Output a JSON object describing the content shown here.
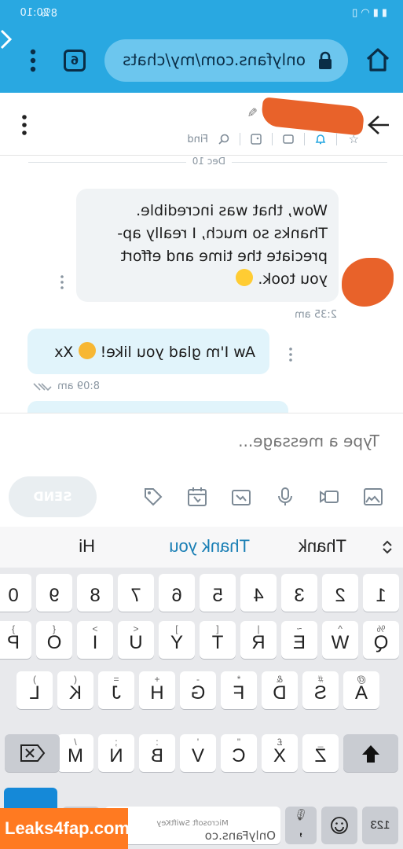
{
  "status_bar": {
    "time": "20:10",
    "battery": "8%"
  },
  "browser": {
    "url": "onlyfans.com/my/chats",
    "tab_count": "6"
  },
  "chat_header": {
    "find_label": "Find"
  },
  "day_label": "Dec 10",
  "messages": [
    {
      "direction": "incoming",
      "lines": [
        "Wow, that was incredible.",
        "Thanks so much, I really ap-",
        "preciate the time and effort",
        "you took."
      ],
      "emoji": "smiling-face",
      "time": "2:35 am"
    },
    {
      "direction": "outgoing",
      "text": "Aw I'm glad you like! ",
      "emoji": "kissing-face",
      "suffix": " Xx",
      "time": "8:09 am"
    }
  ],
  "composer": {
    "placeholder": "Type a message...",
    "send_label": "SEND"
  },
  "keyboard": {
    "suggestions": [
      "Thank",
      "Thank you",
      "Hi"
    ],
    "number_row": [
      "1",
      "2",
      "3",
      "4",
      "5",
      "6",
      "7",
      "8",
      "9",
      "0"
    ],
    "row1": [
      {
        "k": "Q",
        "a": "%"
      },
      {
        "k": "W",
        "a": "^"
      },
      {
        "k": "E",
        "a": "~"
      },
      {
        "k": "R",
        "a": "|"
      },
      {
        "k": "T",
        "a": "["
      },
      {
        "k": "Y",
        "a": "]"
      },
      {
        "k": "U",
        "a": "<"
      },
      {
        "k": "I",
        "a": ">"
      },
      {
        "k": "O",
        "a": "{"
      },
      {
        "k": "P",
        "a": "}"
      }
    ],
    "row2": [
      {
        "k": "A",
        "a": "@"
      },
      {
        "k": "S",
        "a": "#"
      },
      {
        "k": "D",
        "a": "&"
      },
      {
        "k": "F",
        "a": "*"
      },
      {
        "k": "G",
        "a": "-"
      },
      {
        "k": "H",
        "a": "+"
      },
      {
        "k": "J",
        "a": "="
      },
      {
        "k": "K",
        "a": "("
      },
      {
        "k": "L",
        "a": ")"
      }
    ],
    "row3": [
      {
        "k": "Z",
        "a": "_"
      },
      {
        "k": "X",
        "a": "£"
      },
      {
        "k": "C",
        "a": "\""
      },
      {
        "k": "V",
        "a": "'"
      },
      {
        "k": "B",
        "a": ":"
      },
      {
        "k": "N",
        "a": ";"
      },
      {
        "k": "M",
        "a": "/"
      }
    ],
    "numbers_key": "123",
    "comma_key": ",",
    "period_key": ".",
    "space_brand": "Microsoft SwiftKey",
    "enter_label": "↵",
    "url_suggestion": "OnlyFans.co"
  },
  "watermark": "Leaks4fap.com",
  "colors": {
    "browser_bar": "#29a8e1",
    "incoming_bubble": "#f0f3f5",
    "outgoing_bubble": "#e1f4fb",
    "enter_key": "#1589d8",
    "watermark": "#ff7a21"
  }
}
